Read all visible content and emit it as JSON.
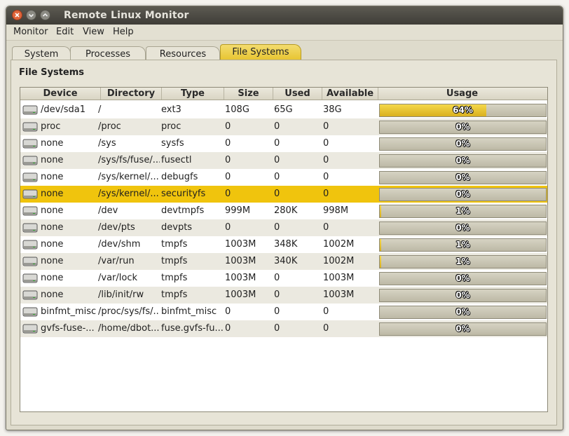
{
  "window": {
    "title": "Remote Linux Monitor"
  },
  "menu": [
    "Monitor",
    "Edit",
    "View",
    "Help"
  ],
  "tabs": [
    "System",
    "Processes",
    "Resources",
    "File Systems"
  ],
  "active_tab": "File Systems",
  "section_title": "File Systems",
  "columns": [
    "Device",
    "Directory",
    "Type",
    "Size",
    "Used",
    "Available",
    "Usage"
  ],
  "accent_color": "#f0c40d",
  "rows": [
    {
      "device": "/dev/sda1",
      "directory": "/",
      "type": "ext3",
      "size": "108G",
      "used": "65G",
      "available": "38G",
      "usage_label": "64%",
      "usage": 0.64
    },
    {
      "device": "proc",
      "directory": "/proc",
      "type": "proc",
      "size": "0",
      "used": "0",
      "available": "0",
      "usage_label": "0%",
      "usage": 0
    },
    {
      "device": "none",
      "directory": "/sys",
      "type": "sysfs",
      "size": "0",
      "used": "0",
      "available": "0",
      "usage_label": "0%",
      "usage": 0
    },
    {
      "device": "none",
      "directory": "/sys/fs/fuse/...",
      "type": "fusectl",
      "size": "0",
      "used": "0",
      "available": "0",
      "usage_label": "0%",
      "usage": 0
    },
    {
      "device": "none",
      "directory": "/sys/kernel/...",
      "type": "debugfs",
      "size": "0",
      "used": "0",
      "available": "0",
      "usage_label": "0%",
      "usage": 0
    },
    {
      "device": "none",
      "directory": "/sys/kernel/...",
      "type": "securityfs",
      "size": "0",
      "used": "0",
      "available": "0",
      "usage_label": "0%",
      "usage": 0,
      "selected": true
    },
    {
      "device": "none",
      "directory": "/dev",
      "type": "devtmpfs",
      "size": "999M",
      "used": "280K",
      "available": "998M",
      "usage_label": "1%",
      "usage": 0.01
    },
    {
      "device": "none",
      "directory": "/dev/pts",
      "type": "devpts",
      "size": "0",
      "used": "0",
      "available": "0",
      "usage_label": "0%",
      "usage": 0
    },
    {
      "device": "none",
      "directory": "/dev/shm",
      "type": "tmpfs",
      "size": "1003M",
      "used": "348K",
      "available": "1002M",
      "usage_label": "1%",
      "usage": 0.01
    },
    {
      "device": "none",
      "directory": "/var/run",
      "type": "tmpfs",
      "size": "1003M",
      "used": "340K",
      "available": "1002M",
      "usage_label": "1%",
      "usage": 0.01
    },
    {
      "device": "none",
      "directory": "/var/lock",
      "type": "tmpfs",
      "size": "1003M",
      "used": "0",
      "available": "1003M",
      "usage_label": "0%",
      "usage": 0
    },
    {
      "device": "none",
      "directory": "/lib/init/rw",
      "type": "tmpfs",
      "size": "1003M",
      "used": "0",
      "available": "1003M",
      "usage_label": "0%",
      "usage": 0
    },
    {
      "device": "binfmt_misc",
      "directory": "/proc/sys/fs/...",
      "type": "binfmt_misc",
      "size": "0",
      "used": "0",
      "available": "0",
      "usage_label": "0%",
      "usage": 0
    },
    {
      "device": "gvfs-fuse-...",
      "directory": "/home/dbot...",
      "type": "fuse.gvfs-fu...",
      "size": "0",
      "used": "0",
      "available": "0",
      "usage_label": "0%",
      "usage": 0
    }
  ]
}
